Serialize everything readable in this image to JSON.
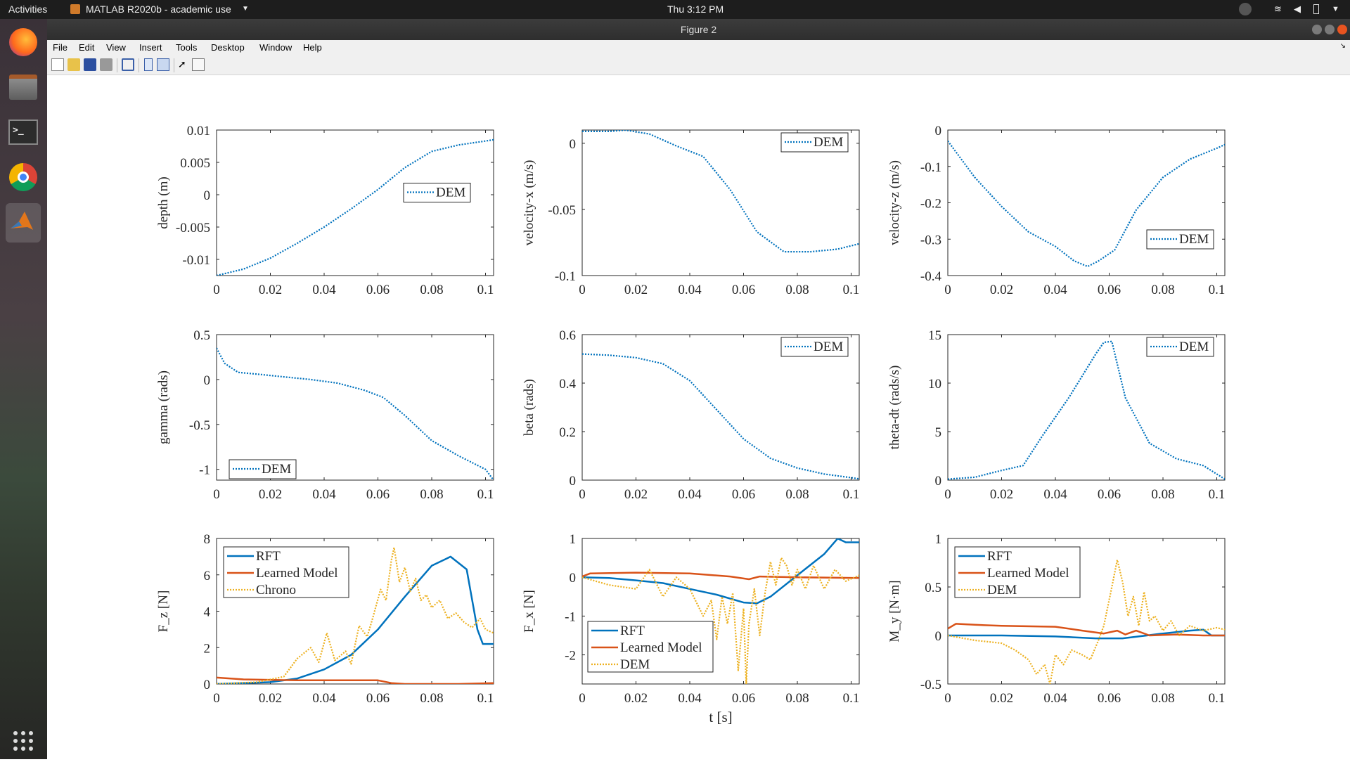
{
  "os": {
    "activities": "Activities",
    "app_menu": "MATLAB R2020b - academic use",
    "clock": "Thu  3:12 PM"
  },
  "dock": [
    "firefox-icon",
    "files-icon",
    "terminal-icon",
    "chrome-icon",
    "matlab-icon",
    "app-grid-icon"
  ],
  "window": {
    "title": "Figure 2"
  },
  "menu": [
    "File",
    "Edit",
    "View",
    "Insert",
    "Tools",
    "Desktop",
    "Window",
    "Help"
  ],
  "toolbar": [
    "new-figure",
    "open-file",
    "save",
    "print",
    "link",
    "docked",
    "figure-palette",
    "select-pointer",
    "property-inspector"
  ],
  "colors": {
    "blue": "#0072BD",
    "orange": "#D95319",
    "yellow": "#EDB120"
  },
  "x_axis_label_bottom_center": "t [s]",
  "chart_data": [
    {
      "type": "line",
      "xlim": [
        0,
        0.103
      ],
      "ylim": [
        -0.0125,
        0.01
      ],
      "xticks": [
        0,
        0.02,
        0.04,
        0.06,
        0.08,
        0.1
      ],
      "xtick_labels": [
        "0",
        "0.02",
        "0.04",
        "0.06",
        "0.08",
        "0.1"
      ],
      "yticks": [
        0.01,
        0.005,
        0,
        -0.005,
        -0.01
      ],
      "ytick_labels": [
        "0.01",
        "0.005",
        "0",
        "-0.005",
        "-0.01"
      ],
      "ylabel": "depth (m)",
      "legend_pos": "right-center",
      "series": [
        {
          "name": "DEM",
          "style": "dotted",
          "color": "#0072BD",
          "x": [
            0,
            0.01,
            0.02,
            0.03,
            0.04,
            0.05,
            0.06,
            0.07,
            0.08,
            0.09,
            0.1,
            0.103
          ],
          "y": [
            -0.0125,
            -0.0115,
            -0.0098,
            -0.0075,
            -0.005,
            -0.0022,
            0.0008,
            0.0042,
            0.0067,
            0.0077,
            0.0083,
            0.0085
          ]
        }
      ]
    },
    {
      "type": "line",
      "xlim": [
        0,
        0.103
      ],
      "ylim": [
        -0.1,
        0.01
      ],
      "xticks": [
        0,
        0.02,
        0.04,
        0.06,
        0.08,
        0.1
      ],
      "xtick_labels": [
        "0",
        "0.02",
        "0.04",
        "0.06",
        "0.08",
        "0.1"
      ],
      "yticks": [
        0,
        -0.05,
        -0.1
      ],
      "ytick_labels": [
        "0",
        "-0.05",
        "-0.1"
      ],
      "ylabel": "velocity-x (m/s)",
      "legend_pos": "top-right",
      "series": [
        {
          "name": "DEM",
          "style": "dotted",
          "color": "#0072BD",
          "x": [
            0,
            0.01,
            0.016,
            0.025,
            0.035,
            0.045,
            0.055,
            0.065,
            0.075,
            0.085,
            0.095,
            0.103
          ],
          "y": [
            0.009,
            0.009,
            0.01,
            0.007,
            -0.002,
            -0.01,
            -0.035,
            -0.067,
            -0.082,
            -0.082,
            -0.08,
            -0.076
          ]
        }
      ]
    },
    {
      "type": "line",
      "xlim": [
        0,
        0.103
      ],
      "ylim": [
        -0.4,
        0
      ],
      "xticks": [
        0,
        0.02,
        0.04,
        0.06,
        0.08,
        0.1
      ],
      "xtick_labels": [
        "0",
        "0.02",
        "0.04",
        "0.06",
        "0.08",
        "0.1"
      ],
      "yticks": [
        0,
        -0.1,
        -0.2,
        -0.3,
        -0.4
      ],
      "ytick_labels": [
        "0",
        "-0.1",
        "-0.2",
        "-0.3",
        "-0.4"
      ],
      "ylabel": "velocity-z (m/s)",
      "legend_pos": "bottom-right",
      "series": [
        {
          "name": "DEM",
          "style": "dotted",
          "color": "#0072BD",
          "x": [
            0,
            0.01,
            0.02,
            0.03,
            0.04,
            0.047,
            0.052,
            0.056,
            0.062,
            0.07,
            0.08,
            0.09,
            0.1,
            0.103
          ],
          "y": [
            -0.03,
            -0.13,
            -0.21,
            -0.28,
            -0.32,
            -0.36,
            -0.375,
            -0.36,
            -0.33,
            -0.22,
            -0.13,
            -0.08,
            -0.05,
            -0.04
          ]
        }
      ]
    },
    {
      "type": "line",
      "xlim": [
        0,
        0.103
      ],
      "ylim": [
        -1.12,
        0.5
      ],
      "xticks": [
        0,
        0.02,
        0.04,
        0.06,
        0.08,
        0.1
      ],
      "xtick_labels": [
        "0",
        "0.02",
        "0.04",
        "0.06",
        "0.08",
        "0.1"
      ],
      "yticks": [
        0.5,
        0,
        -0.5,
        -1
      ],
      "ytick_labels": [
        "0.5",
        "0",
        "-0.5",
        "-1"
      ],
      "ylabel": "gamma (rads)",
      "legend_pos": "bottom-left",
      "series": [
        {
          "name": "DEM",
          "style": "dotted",
          "color": "#0072BD",
          "x": [
            0,
            0.003,
            0.008,
            0.015,
            0.025,
            0.035,
            0.045,
            0.055,
            0.062,
            0.07,
            0.08,
            0.09,
            0.1,
            0.103
          ],
          "y": [
            0.35,
            0.18,
            0.08,
            0.06,
            0.03,
            0,
            -0.04,
            -0.12,
            -0.2,
            -0.4,
            -0.68,
            -0.85,
            -1.0,
            -1.12
          ]
        }
      ]
    },
    {
      "type": "line",
      "xlim": [
        0,
        0.103
      ],
      "ylim": [
        0,
        0.6
      ],
      "xticks": [
        0,
        0.02,
        0.04,
        0.06,
        0.08,
        0.1
      ],
      "xtick_labels": [
        "0",
        "0.02",
        "0.04",
        "0.06",
        "0.08",
        "0.1"
      ],
      "yticks": [
        0,
        0.2,
        0.4,
        0.6
      ],
      "ytick_labels": [
        "0",
        "0.2",
        "0.4",
        "0.6"
      ],
      "ylabel": "beta (rads)",
      "legend_pos": "top-right",
      "series": [
        {
          "name": "DEM",
          "style": "dotted",
          "color": "#0072BD",
          "x": [
            0,
            0.01,
            0.02,
            0.03,
            0.04,
            0.05,
            0.06,
            0.07,
            0.08,
            0.09,
            0.1,
            0.103
          ],
          "y": [
            0.52,
            0.515,
            0.505,
            0.48,
            0.41,
            0.29,
            0.17,
            0.09,
            0.05,
            0.025,
            0.01,
            0.005
          ]
        }
      ]
    },
    {
      "type": "line",
      "xlim": [
        0,
        0.103
      ],
      "ylim": [
        0,
        15
      ],
      "xticks": [
        0,
        0.02,
        0.04,
        0.06,
        0.08,
        0.1
      ],
      "xtick_labels": [
        "0",
        "0.02",
        "0.04",
        "0.06",
        "0.08",
        "0.1"
      ],
      "yticks": [
        0,
        5,
        10,
        15
      ],
      "ytick_labels": [
        "0",
        "5",
        "10",
        "15"
      ],
      "ylabel": "theta-dt (rads/s)",
      "legend_pos": "top-right",
      "series": [
        {
          "name": "DEM",
          "style": "dotted",
          "color": "#0072BD",
          "x": [
            0,
            0.01,
            0.02,
            0.028,
            0.035,
            0.045,
            0.055,
            0.058,
            0.061,
            0.066,
            0.075,
            0.085,
            0.095,
            0.103
          ],
          "y": [
            0.1,
            0.3,
            1.0,
            1.5,
            4.5,
            8.5,
            13,
            14.2,
            14.3,
            8.5,
            3.8,
            2.2,
            1.5,
            0.1
          ]
        }
      ]
    },
    {
      "type": "line",
      "xlim": [
        0,
        0.103
      ],
      "ylim": [
        0,
        8
      ],
      "xticks": [
        0,
        0.02,
        0.04,
        0.06,
        0.08,
        0.1
      ],
      "xtick_labels": [
        "0",
        "0.02",
        "0.04",
        "0.06",
        "0.08",
        "0.1"
      ],
      "yticks": [
        0,
        2,
        4,
        6,
        8
      ],
      "ytick_labels": [
        "0",
        "2",
        "4",
        "6",
        "8"
      ],
      "ylabel": "F_z [N]",
      "legend_pos": "top-left",
      "series": [
        {
          "name": "RFT",
          "style": "solid",
          "color": "#0072BD",
          "x": [
            0,
            0.01,
            0.02,
            0.03,
            0.04,
            0.05,
            0.06,
            0.07,
            0.08,
            0.087,
            0.093,
            0.097,
            0.099,
            0.103
          ],
          "y": [
            0,
            0.05,
            0.1,
            0.3,
            0.8,
            1.6,
            3.0,
            4.8,
            6.5,
            7.0,
            6.3,
            3.0,
            2.2,
            2.2
          ]
        },
        {
          "name": "Learned Model",
          "style": "solid",
          "color": "#D95319",
          "x": [
            0,
            0.01,
            0.03,
            0.06,
            0.065,
            0.07,
            0.09,
            0.103
          ],
          "y": [
            0.35,
            0.25,
            0.2,
            0.2,
            0.05,
            0,
            0,
            0.05
          ]
        },
        {
          "name": "Chrono",
          "style": "dotted",
          "color": "#EDB120",
          "x": [
            0,
            0.015,
            0.025,
            0.03,
            0.035,
            0.038,
            0.041,
            0.044,
            0.048,
            0.05,
            0.053,
            0.056,
            0.058,
            0.061,
            0.063,
            0.065,
            0.066,
            0.068,
            0.07,
            0.072,
            0.074,
            0.076,
            0.078,
            0.08,
            0.083,
            0.086,
            0.089,
            0.092,
            0.095,
            0.098,
            0.1,
            0.103
          ],
          "y": [
            0,
            0.1,
            0.4,
            1.4,
            2.0,
            1.2,
            2.8,
            1.3,
            1.8,
            1.1,
            3.2,
            2.6,
            3.6,
            5.2,
            4.6,
            6.8,
            7.5,
            5.6,
            6.4,
            5.1,
            5.8,
            4.6,
            4.9,
            4.2,
            4.6,
            3.6,
            3.9,
            3.4,
            3.1,
            3.6,
            3.0,
            2.8
          ]
        }
      ]
    },
    {
      "type": "line",
      "xlim": [
        0,
        0.103
      ],
      "ylim": [
        -2.75,
        1
      ],
      "xticks": [
        0,
        0.02,
        0.04,
        0.06,
        0.08,
        0.1
      ],
      "xtick_labels": [
        "0",
        "0.02",
        "0.04",
        "0.06",
        "0.08",
        "0.1"
      ],
      "yticks": [
        1,
        0,
        -1,
        -2
      ],
      "ytick_labels": [
        "1",
        "0",
        "-1",
        "-2"
      ],
      "ylabel": "F_x [N]",
      "xlabel": "t [s]",
      "legend_pos": "bottom-left",
      "series": [
        {
          "name": "RFT",
          "style": "solid",
          "color": "#0072BD",
          "x": [
            0,
            0.01,
            0.02,
            0.03,
            0.04,
            0.05,
            0.06,
            0.065,
            0.07,
            0.08,
            0.09,
            0.095,
            0.098,
            0.103
          ],
          "y": [
            0,
            -0.02,
            -0.08,
            -0.15,
            -0.3,
            -0.45,
            -0.65,
            -0.67,
            -0.5,
            0.05,
            0.6,
            1.0,
            0.9,
            0.9
          ]
        },
        {
          "name": "Learned Model",
          "style": "solid",
          "color": "#D95319",
          "x": [
            0,
            0.003,
            0.02,
            0.04,
            0.055,
            0.062,
            0.066,
            0.08,
            0.103
          ],
          "y": [
            0.02,
            0.1,
            0.12,
            0.1,
            0.02,
            -0.05,
            0.02,
            0,
            -0.02
          ]
        },
        {
          "name": "DEM",
          "style": "dotted",
          "color": "#EDB120",
          "x": [
            0,
            0.01,
            0.02,
            0.025,
            0.03,
            0.035,
            0.04,
            0.045,
            0.048,
            0.05,
            0.052,
            0.054,
            0.056,
            0.058,
            0.06,
            0.061,
            0.062,
            0.064,
            0.066,
            0.068,
            0.07,
            0.072,
            0.074,
            0.076,
            0.078,
            0.08,
            0.083,
            0.086,
            0.09,
            0.094,
            0.098,
            0.103
          ],
          "y": [
            0,
            -0.2,
            -0.3,
            0.2,
            -0.5,
            0,
            -0.3,
            -1.0,
            -0.6,
            -1.6,
            -0.5,
            -1.2,
            -0.4,
            -2.4,
            -0.8,
            -2.75,
            -1.2,
            -0.3,
            -1.5,
            -0.4,
            0.4,
            -0.2,
            0.5,
            0.3,
            -0.2,
            0.2,
            -0.3,
            0.3,
            -0.3,
            0.2,
            -0.1,
            0.05
          ]
        }
      ]
    },
    {
      "type": "line",
      "xlim": [
        0,
        0.103
      ],
      "ylim": [
        -0.5,
        1
      ],
      "xticks": [
        0,
        0.02,
        0.04,
        0.06,
        0.08,
        0.1
      ],
      "xtick_labels": [
        "0",
        "0.02",
        "0.04",
        "0.06",
        "0.08",
        "0.1"
      ],
      "yticks": [
        1,
        0.5,
        0,
        -0.5
      ],
      "ytick_labels": [
        "1",
        "0.5",
        "0",
        "-0.5"
      ],
      "ylabel": "M_y [N·m]",
      "legend_pos": "top-left",
      "series": [
        {
          "name": "RFT",
          "style": "solid",
          "color": "#0072BD",
          "x": [
            0,
            0.02,
            0.04,
            0.055,
            0.065,
            0.08,
            0.09,
            0.095,
            0.098,
            0.103
          ],
          "y": [
            0,
            0,
            -0.01,
            -0.03,
            -0.03,
            0.02,
            0.05,
            0.06,
            0.0,
            0.0
          ]
        },
        {
          "name": "Learned Model",
          "style": "solid",
          "color": "#D95319",
          "x": [
            0,
            0.003,
            0.01,
            0.02,
            0.04,
            0.05,
            0.058,
            0.063,
            0.066,
            0.07,
            0.075,
            0.085,
            0.095,
            0.103
          ],
          "y": [
            0.07,
            0.12,
            0.11,
            0.1,
            0.09,
            0.05,
            0.02,
            0.05,
            0.01,
            0.05,
            0,
            0.01,
            0,
            0
          ]
        },
        {
          "name": "DEM",
          "style": "dotted",
          "color": "#EDB120",
          "x": [
            0,
            0.01,
            0.02,
            0.025,
            0.03,
            0.033,
            0.036,
            0.038,
            0.04,
            0.043,
            0.046,
            0.05,
            0.053,
            0.056,
            0.058,
            0.061,
            0.063,
            0.065,
            0.067,
            0.069,
            0.071,
            0.073,
            0.075,
            0.077,
            0.08,
            0.083,
            0.086,
            0.09,
            0.095,
            0.1,
            0.103
          ],
          "y": [
            0,
            -0.05,
            -0.08,
            -0.15,
            -0.25,
            -0.4,
            -0.3,
            -0.5,
            -0.2,
            -0.3,
            -0.15,
            -0.2,
            -0.25,
            -0.05,
            0.1,
            0.5,
            0.78,
            0.55,
            0.2,
            0.4,
            0.1,
            0.45,
            0.15,
            0.2,
            0.05,
            0.15,
            0,
            0.1,
            0.05,
            0.08,
            0.06
          ]
        }
      ]
    }
  ]
}
